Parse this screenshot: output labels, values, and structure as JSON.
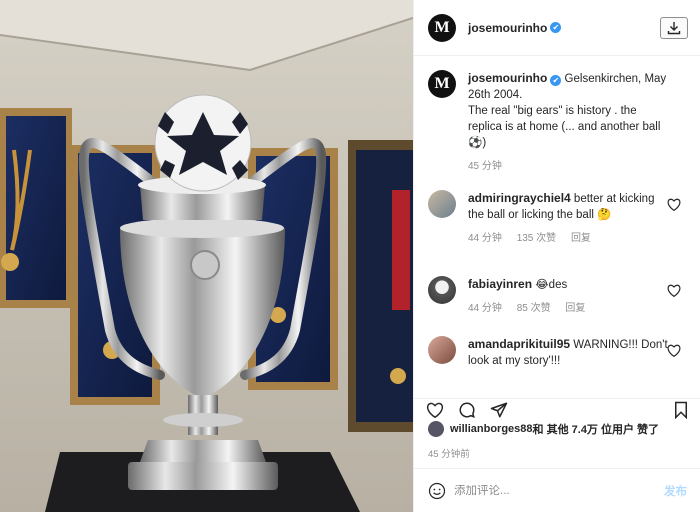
{
  "header": {
    "username": "josemourinho",
    "verified_mark": "✔",
    "avatar_letter": "M"
  },
  "caption": {
    "username": "josemourinho",
    "text": "Gelsenkirchen, May 26th 2004.\nThe real \"big ears\" is history . the replica is at home (... and another ball ⚽)",
    "time": "45 分钟"
  },
  "comments": [
    {
      "username": "admiringraychiel4",
      "text": "better at kicking the ball or licking the ball 🤔",
      "time": "44 分钟",
      "likes": "135 次赞",
      "reply": "回复"
    },
    {
      "username": "fabiayinren",
      "text": "😂des",
      "time": "44 分钟",
      "likes": "85 次赞",
      "reply": "回复"
    },
    {
      "username": "amandaprikituil95",
      "text": "WARNING!!! Don't look at my story'!!!"
    }
  ],
  "likes_line": {
    "user": "willianborges88",
    "text": " 和 其他 7.4万 位用户 赞了"
  },
  "post_time": "45 分钟前",
  "add_comment": {
    "placeholder": "添加评论...",
    "publish": "发布"
  },
  "icons": {
    "download": "download-icon",
    "emoji": "emoji-icon",
    "heart": "heart-icon",
    "comment": "comment-icon",
    "share": "share-icon",
    "save": "bookmark-icon"
  },
  "colors": {
    "verified": "#3897f0",
    "publish_disabled": "#b3dbff",
    "meta_gray": "#8e8e8e"
  }
}
